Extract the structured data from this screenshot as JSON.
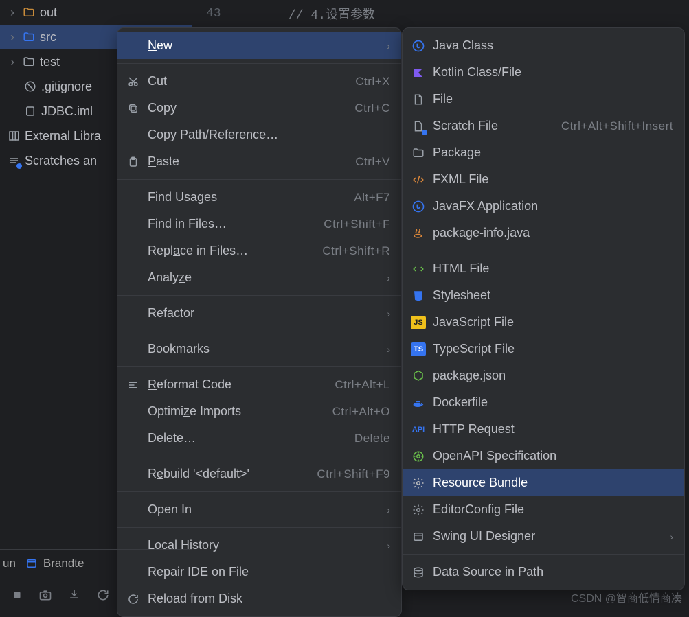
{
  "editor": {
    "line": "43",
    "code": "// 4.设置参数"
  },
  "tree": {
    "out": {
      "label": "out"
    },
    "src": {
      "label": "src"
    },
    "test": {
      "label": "test"
    },
    "gitignore": {
      "label": ".gitignore"
    },
    "iml": {
      "label": "JDBC.iml"
    },
    "ext": {
      "label": "External Libra"
    },
    "scr": {
      "label": "Scratches an"
    }
  },
  "menu": {
    "new": {
      "label": "New"
    },
    "cut": {
      "label": "Cut",
      "shortcut": "Ctrl+X"
    },
    "copy": {
      "label": "Copy",
      "shortcut": "Ctrl+C"
    },
    "copypath": {
      "label": "Copy Path/Reference…"
    },
    "paste": {
      "label": "Paste",
      "shortcut": "Ctrl+V"
    },
    "findu": {
      "label": "Find Usages",
      "shortcut": "Alt+F7"
    },
    "findf": {
      "label": "Find in Files…",
      "shortcut": "Ctrl+Shift+F"
    },
    "repl": {
      "label": "Replace in Files…",
      "shortcut": "Ctrl+Shift+R"
    },
    "analyze": {
      "label": "Analyze"
    },
    "refactor": {
      "label": "Refactor"
    },
    "bookmarks": {
      "label": "Bookmarks"
    },
    "reformat": {
      "label": "Reformat Code",
      "shortcut": "Ctrl+Alt+L"
    },
    "optimize": {
      "label": "Optimize Imports",
      "shortcut": "Ctrl+Alt+O"
    },
    "delete": {
      "label": "Delete…",
      "shortcut": "Delete"
    },
    "rebuild": {
      "label": "Rebuild '<default>'",
      "shortcut": "Ctrl+Shift+F9"
    },
    "openin": {
      "label": "Open In"
    },
    "history": {
      "label": "Local History"
    },
    "repair": {
      "label": "Repair IDE on File"
    },
    "reload": {
      "label": "Reload from Disk"
    }
  },
  "submenu": {
    "javaclass": {
      "label": "Java Class"
    },
    "kotlin": {
      "label": "Kotlin Class/File"
    },
    "file": {
      "label": "File"
    },
    "scratch": {
      "label": "Scratch File",
      "shortcut": "Ctrl+Alt+Shift+Insert"
    },
    "package": {
      "label": "Package"
    },
    "fxml": {
      "label": "FXML File"
    },
    "javafx": {
      "label": "JavaFX Application"
    },
    "pkginfo": {
      "label": "package-info.java"
    },
    "html": {
      "label": "HTML File"
    },
    "stylesheet": {
      "label": "Stylesheet"
    },
    "jsfile": {
      "label": "JavaScript File"
    },
    "tsfile": {
      "label": "TypeScript File"
    },
    "pkgjson": {
      "label": "package.json"
    },
    "dockerfile": {
      "label": "Dockerfile"
    },
    "http": {
      "label": "HTTP Request"
    },
    "openapi": {
      "label": "OpenAPI Specification"
    },
    "resbundle": {
      "label": "Resource Bundle"
    },
    "editorcfg": {
      "label": "EditorConfig File"
    },
    "swing": {
      "label": "Swing UI Designer"
    },
    "datasrc": {
      "label": "Data Source in Path"
    }
  },
  "footer": {
    "run": "un",
    "brand": "Brandte"
  },
  "watermark": "CSDN @智商低情商凑"
}
